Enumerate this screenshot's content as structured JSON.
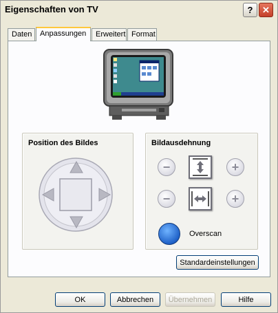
{
  "window": {
    "title": "Eigenschaften von TV",
    "help_glyph": "?",
    "close_glyph": "✕"
  },
  "tabs": [
    {
      "label": "Daten",
      "active": false
    },
    {
      "label": "Anpassungen",
      "active": true
    },
    {
      "label": "Erweitert",
      "active": false
    },
    {
      "label": "Format",
      "active": false
    }
  ],
  "position_group": {
    "title": "Position des Bildes"
  },
  "scale_group": {
    "title": "Bildausdehnung",
    "minus_glyph": "−",
    "plus_glyph": "+",
    "overscan_label": "Overscan"
  },
  "defaults_button": "Standardeinstellungen",
  "footer": {
    "ok": "OK",
    "cancel": "Abbrechen",
    "apply": "Übernehmen",
    "help": "Hilfe"
  },
  "colors": {
    "overscan_button": "#1A5CC4",
    "tab_highlight": "#FFC83C"
  }
}
